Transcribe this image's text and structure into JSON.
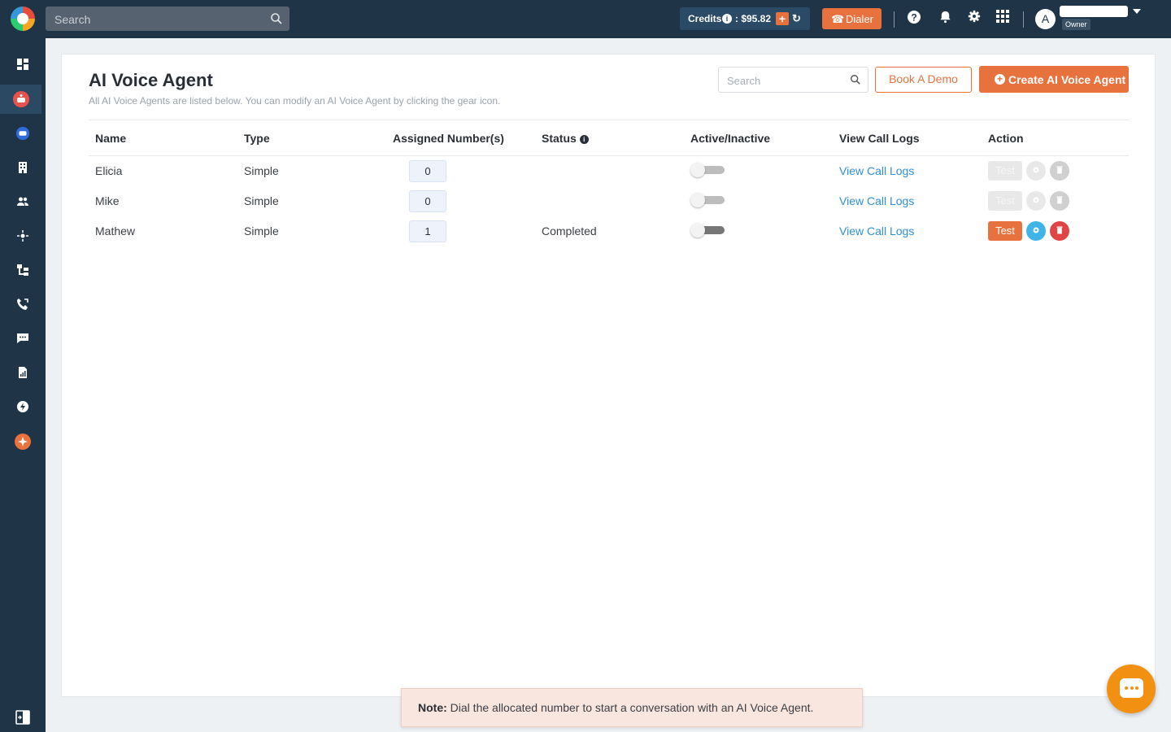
{
  "topbar": {
    "search_placeholder": "Search",
    "credits_label": "Credits",
    "credits_info": "i",
    "credits_amount": ": $95.82",
    "credits_plus": "+",
    "dialer_label": "Dialer",
    "avatar_letter": "A",
    "user_role": "Owner"
  },
  "page": {
    "title": "AI Voice Agent",
    "subtitle": "All AI Voice Agents are listed below. You can modify an AI Voice Agent by clicking the gear icon.",
    "search_placeholder": "Search",
    "book_demo_label": "Book A Demo",
    "create_label": "Create AI Voice Agent"
  },
  "table": {
    "headers": [
      "Name",
      "Type",
      "Assigned Number(s)",
      "Status",
      "Active/Inactive",
      "View Call Logs",
      "Action"
    ],
    "rows": [
      {
        "name": "Elicia",
        "type": "Simple",
        "assigned": "0",
        "status": "",
        "logs": "View Call Logs",
        "test": "Test",
        "active": false,
        "enabled": false
      },
      {
        "name": "Mike",
        "type": "Simple",
        "assigned": "0",
        "status": "",
        "logs": "View Call Logs",
        "test": "Test",
        "active": false,
        "enabled": false
      },
      {
        "name": "Mathew",
        "type": "Simple",
        "assigned": "1",
        "status": "Completed",
        "logs": "View Call Logs",
        "test": "Test",
        "active": false,
        "enabled": true
      }
    ]
  },
  "note": {
    "label": "Note:",
    "text": "Dial the allocated number to start a conversation with an AI Voice Agent."
  },
  "colors": {
    "topbar": "#1f3447",
    "accent": "#e8723e",
    "link": "#2e8fd6",
    "chat": "#f29111"
  },
  "icons": {
    "sidebar": [
      "dashboard-icon",
      "ai-agent-icon",
      "chatbot-icon",
      "building-icon",
      "contacts-icon",
      "integrations-icon",
      "workflow-icon",
      "call-icon",
      "messages-icon",
      "reports-icon",
      "automation-icon",
      "sparkle-icon",
      "collapse-icon"
    ],
    "topbar": [
      "search-icon",
      "help-icon",
      "bell-icon",
      "gear-icon",
      "apps-grid-icon"
    ]
  }
}
